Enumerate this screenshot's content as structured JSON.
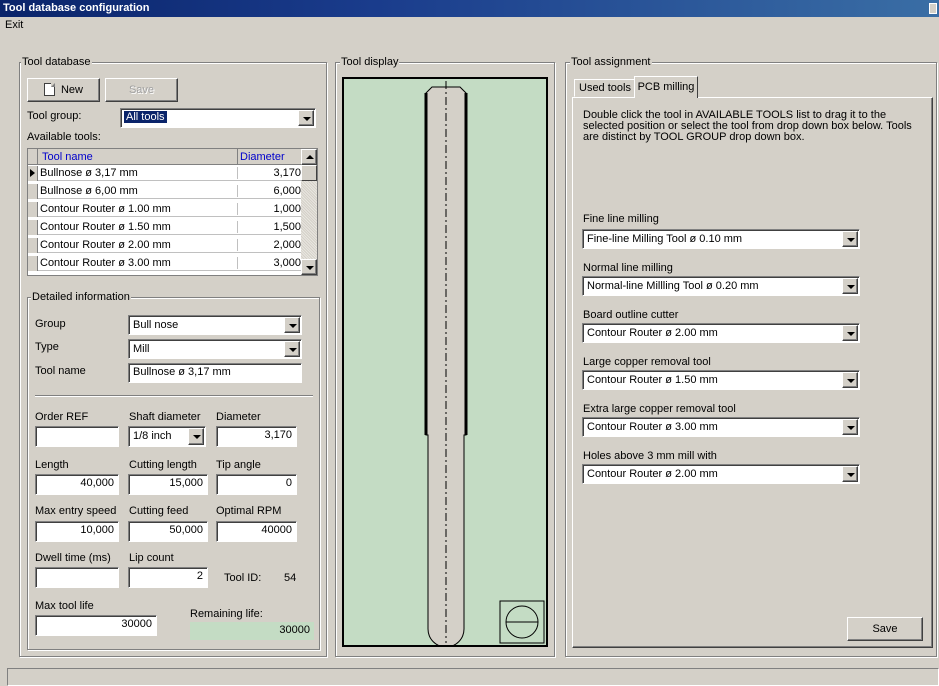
{
  "window": {
    "title": "Tool database configuration"
  },
  "menu": {
    "exit": "Exit"
  },
  "tool_database": {
    "group_title": "Tool database",
    "new_label": "New",
    "save_label": "Save",
    "tool_group_label": "Tool group:",
    "tool_group_value": "All tools",
    "available_label": "Available tools:",
    "columns": {
      "name": "Tool name",
      "diameter": "Diameter"
    },
    "rows": [
      {
        "name": "Bullnose ø 3,17 mm",
        "diameter": "3,170"
      },
      {
        "name": "Bullnose ø 6,00 mm",
        "diameter": "6,000"
      },
      {
        "name": "Contour Router ø 1.00 mm",
        "diameter": "1,000"
      },
      {
        "name": "Contour Router ø 1.50 mm",
        "diameter": "1,500"
      },
      {
        "name": "Contour Router ø 2.00 mm",
        "diameter": "2,000"
      },
      {
        "name": "Contour Router ø 3.00 mm",
        "diameter": "3,000"
      }
    ]
  },
  "details": {
    "group_title": "Detailed information",
    "group_label": "Group",
    "group_value": "Bull nose",
    "type_label": "Type",
    "type_value": "Mill",
    "tool_name_label": "Tool name",
    "tool_name_value": "Bullnose ø 3,17 mm",
    "order_ref_label": "Order REF",
    "order_ref_value": "",
    "shaft_label": "Shaft diameter",
    "shaft_value": "1/8 inch",
    "diameter_label": "Diameter",
    "diameter_value": "3,170",
    "length_label": "Length",
    "length_value": "40,000",
    "cutting_length_label": "Cutting length",
    "cutting_length_value": "15,000",
    "tip_angle_label": "Tip angle",
    "tip_angle_value": "0",
    "max_entry_label": "Max entry speed",
    "max_entry_value": "10,000",
    "cutting_feed_label": "Cutting feed",
    "cutting_feed_value": "50,000",
    "optimal_rpm_label": "Optimal RPM",
    "optimal_rpm_value": "40000",
    "dwell_label": "Dwell time (ms)",
    "dwell_value": "",
    "lip_label": "Lip count",
    "lip_value": "2",
    "tool_id_label": "Tool ID:",
    "tool_id_value": "54",
    "max_life_label": "Max tool life",
    "max_life_value": "30000",
    "remaining_label": "Remaining life:",
    "remaining_value": "30000"
  },
  "tool_display": {
    "group_title": "Tool display"
  },
  "tool_assignment": {
    "group_title": "Tool assignment",
    "tabs": [
      "Used tools",
      "PCB milling"
    ],
    "instructions": "Double click the tool in AVAILABLE TOOLS list to drag it to the selected position or select the tool from drop down box below. Tools are distinct by TOOL GROUP drop down box.",
    "assignments": [
      {
        "label": "Fine line milling",
        "value": "Fine-line Milling Tool ø 0.10 mm"
      },
      {
        "label": "Normal line milling",
        "value": "Normal-line Millling Tool ø 0.20 mm"
      },
      {
        "label": "Board outline cutter",
        "value": "Contour Router ø 2.00 mm"
      },
      {
        "label": "Large copper removal tool",
        "value": "Contour Router ø 1.50 mm"
      },
      {
        "label": "Extra large copper removal tool",
        "value": "Contour Router ø 3.00 mm"
      },
      {
        "label": "Holes above 3 mm mill with",
        "value": "Contour Router ø 2.00 mm"
      }
    ],
    "save_label": "Save"
  },
  "colors": {
    "title_bar": "#0a246a",
    "display_bg": "#c4dcc4",
    "remaining_bg": "#c4dcc4"
  }
}
